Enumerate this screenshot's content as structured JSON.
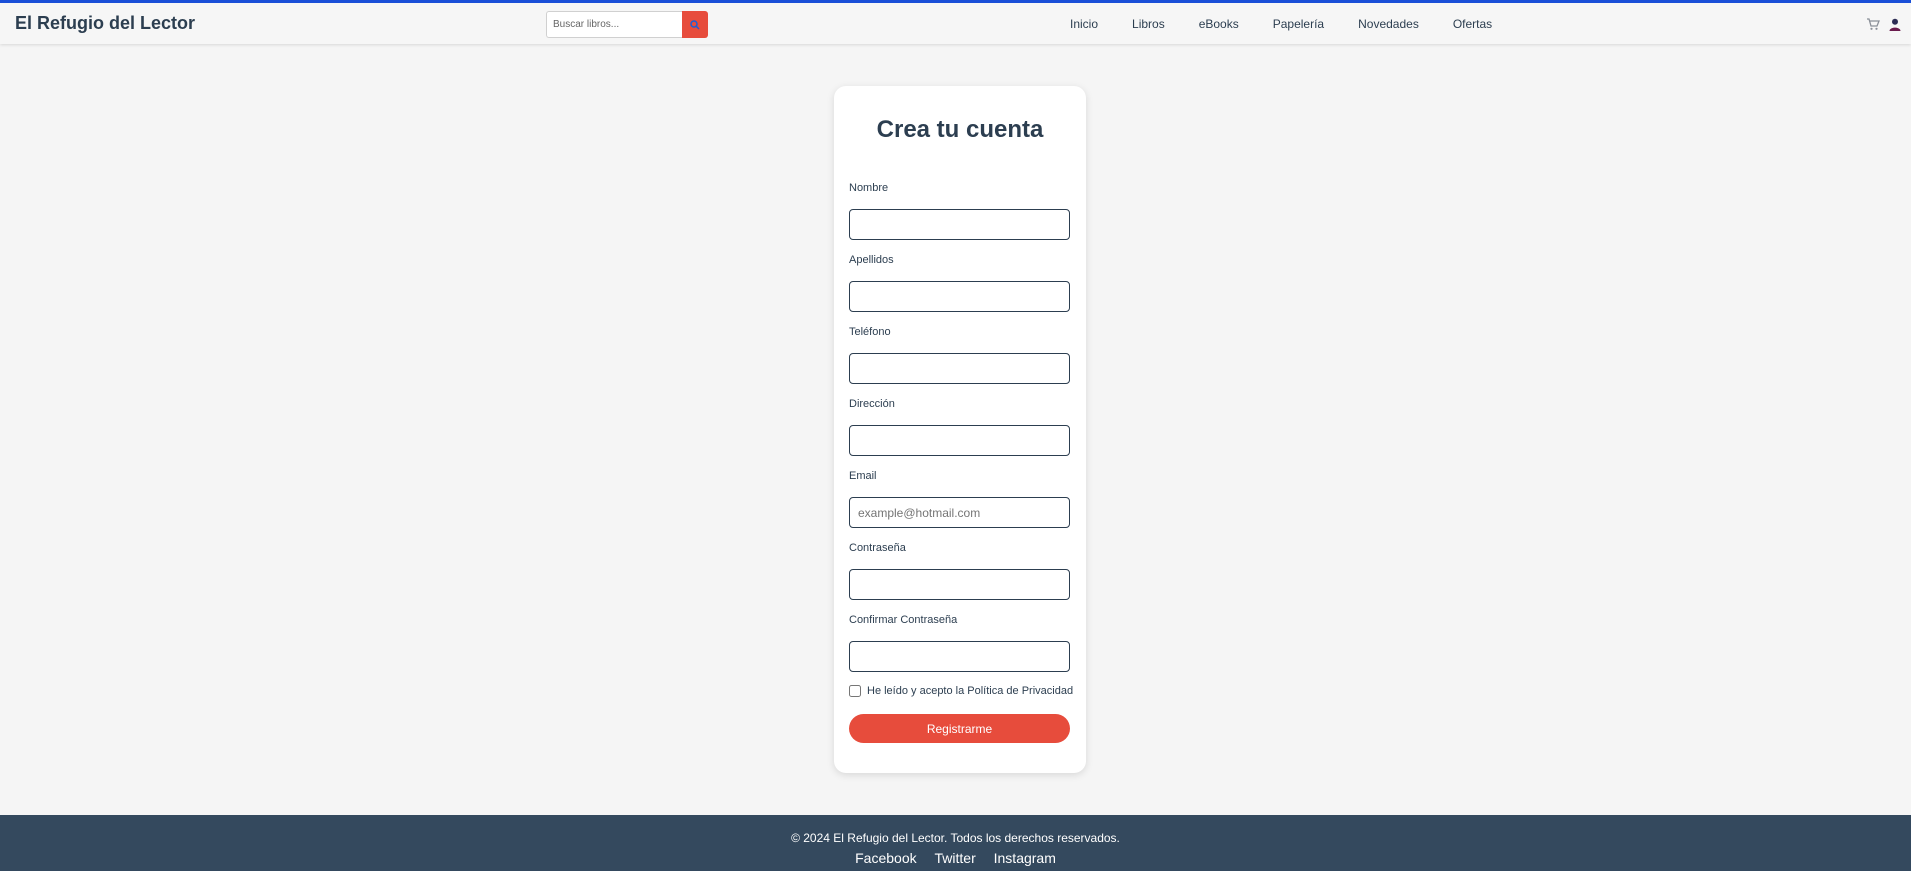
{
  "header": {
    "brand": "El Refugio del Lector",
    "search_placeholder": "Buscar libros...",
    "nav": [
      "Inicio",
      "Libros",
      "eBooks",
      "Papelería",
      "Novedades",
      "Ofertas"
    ],
    "icons": [
      "search-icon",
      "cart-icon",
      "user-icon"
    ],
    "accent_color": "#e74c3c",
    "top_border_color": "#1a4fd8"
  },
  "form": {
    "title": "Crea tu cuenta",
    "fields": [
      {
        "label": "Nombre",
        "value": "",
        "placeholder": ""
      },
      {
        "label": "Apellidos",
        "value": "",
        "placeholder": ""
      },
      {
        "label": "Teléfono",
        "value": "",
        "placeholder": ""
      },
      {
        "label": "Dirección",
        "value": "",
        "placeholder": ""
      },
      {
        "label": "Email",
        "value": "",
        "placeholder": "example@hotmail.com"
      },
      {
        "label": "Contraseña",
        "value": "",
        "placeholder": ""
      },
      {
        "label": "Confirmar Contraseña",
        "value": "",
        "placeholder": ""
      }
    ],
    "consent_label": "He leído y acepto la Política de Privacidad",
    "consent_checked": false,
    "submit_label": "Registrarme"
  },
  "footer": {
    "copyright": "© 2024 El Refugio del Lector. Todos los derechos reservados.",
    "links": [
      "Facebook",
      "Twitter",
      "Instagram"
    ],
    "background_color": "#34495e"
  }
}
